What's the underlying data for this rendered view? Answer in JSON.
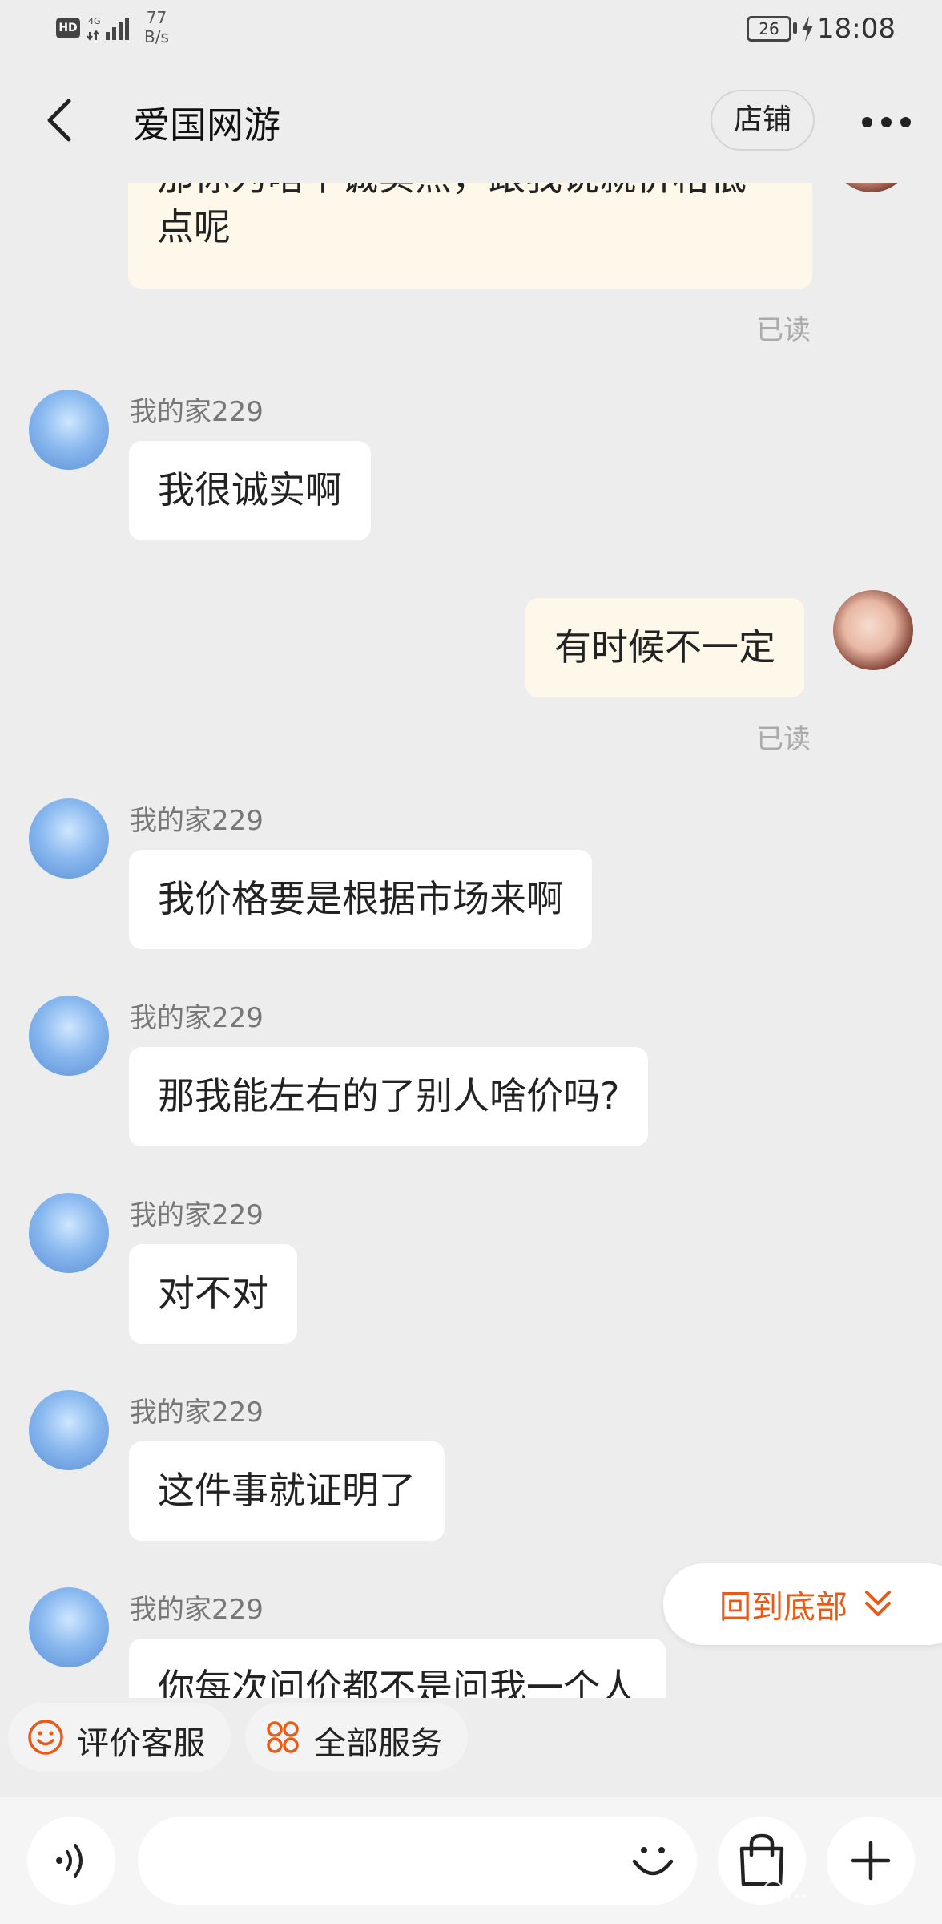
{
  "status_bar": {
    "hd": "HD",
    "network": "4G",
    "speed_value": "77",
    "speed_unit": "B/s",
    "battery": "26",
    "time": "18:08"
  },
  "header": {
    "title": "爱国网游",
    "store_label": "店铺"
  },
  "messages": [
    {
      "side": "out",
      "text_line1": "那你为啥不诚实点，跟我说就价格低",
      "text_line2": "点呢",
      "read": "已读"
    },
    {
      "side": "in",
      "sender": "我的家229",
      "text": "我很诚实啊"
    },
    {
      "side": "out",
      "text": "有时候不一定",
      "read": "已读"
    },
    {
      "side": "in",
      "sender": "我的家229",
      "text": "我价格要是根据市场来啊"
    },
    {
      "side": "in",
      "sender": "我的家229",
      "text": "那我能左右的了别人啥价吗?"
    },
    {
      "side": "in",
      "sender": "我的家229",
      "text": "对不对"
    },
    {
      "side": "in",
      "sender": "我的家229",
      "text": "这件事就证明了"
    },
    {
      "side": "in",
      "sender": "我的家229",
      "text": "你每次问价都不是问我一个人"
    }
  ],
  "back_to_bottom": {
    "label": "回到底部"
  },
  "quick_actions": [
    {
      "label": "评价客服",
      "icon": "smile-icon"
    },
    {
      "label": "全部服务",
      "icon": "grid-icon"
    }
  ],
  "colors": {
    "accent": "#e85a16",
    "out_bubble": "#fdf8e9",
    "in_bubble": "#ffffff",
    "background": "#ededed"
  },
  "watermark": "@..."
}
